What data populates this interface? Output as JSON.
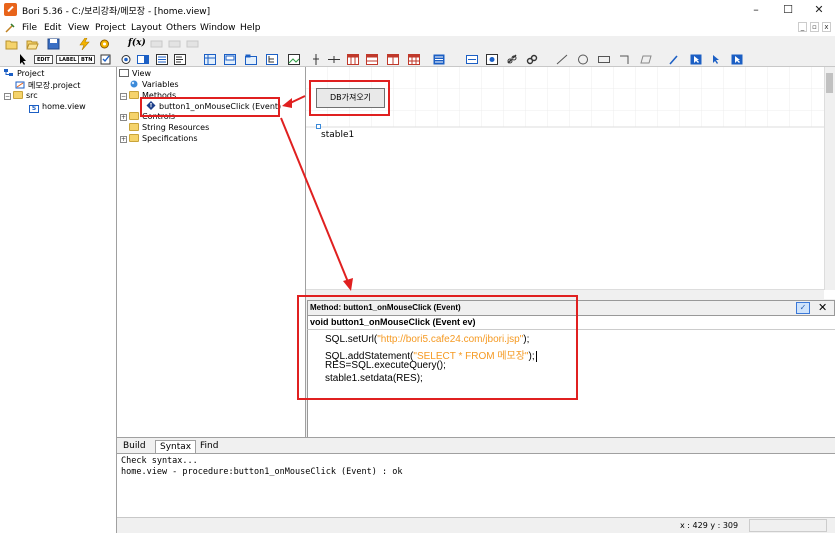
{
  "window": {
    "title": "Bori 5.36 - C:/보리강좌/메모장 - [home.view]",
    "minimize": "–",
    "maximize": "☐",
    "close": "✕"
  },
  "menu": [
    "File",
    "Edit",
    "View",
    "Project",
    "Layout",
    "Others",
    "Window",
    "Help"
  ],
  "mdi_controls": [
    "_",
    "▫",
    "x"
  ],
  "toolbar": {
    "text_tools": [
      "EDIT",
      "LABEL",
      "BTN"
    ],
    "func_label": "f(x)"
  },
  "project_tree": {
    "root": "Project",
    "project_file": "메모장.project",
    "src_folder": "src",
    "view_file": "home.view"
  },
  "view_tree": {
    "root": "View",
    "variables": "Variables",
    "methods": "Methods",
    "method_item": "button1_onMouseClick (Event)",
    "controls": "Controls",
    "string_resources": "String Resources",
    "specifications": "Specifications"
  },
  "design": {
    "button_label": "DB가져오기",
    "table_label": "stable1"
  },
  "method_editor": {
    "header": "Method: button1_onMouseClick (Event)",
    "signature": "void button1_onMouseClick (Event ev)",
    "code": [
      {
        "pre": "SQL.setUrl(",
        "str": "\"http://bori5.cafe24.com/jbori.jsp\"",
        "post": ");"
      },
      {
        "pre": "SQL.addStatement(",
        "str": "\"SELECT * FROM 메모장\"",
        "post": ");"
      },
      {
        "pre": "RES=SQL.executeQuery();",
        "str": "",
        "post": ""
      },
      {
        "pre": "stable1.setdata(RES);",
        "str": "",
        "post": ""
      }
    ]
  },
  "output": {
    "tabs": [
      "Build",
      "Syntax",
      "Find"
    ],
    "active_tab": "Syntax",
    "lines": [
      "Check syntax...",
      "home.view - procedure:button1_onMouseClick (Event) : ok"
    ]
  },
  "status": {
    "coords": "x : 429  y : 309"
  },
  "colors": {
    "annotation_red": "#e02020",
    "string_orange": "#f59a23",
    "folder_yellow": "#f5d36b"
  }
}
